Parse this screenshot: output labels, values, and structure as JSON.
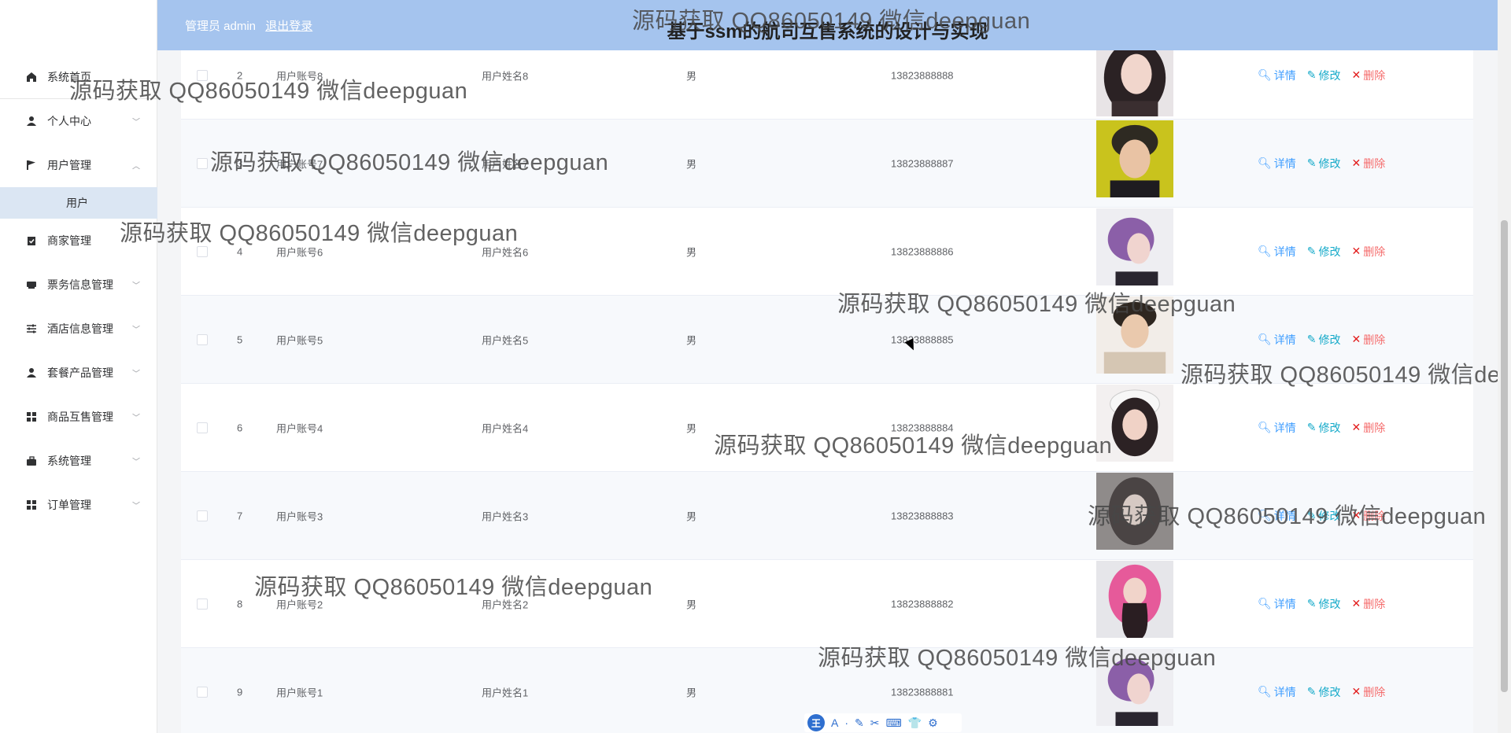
{
  "header": {
    "user_label": "管理员 admin",
    "logout_label": "退出登录",
    "title": "基于ssm的航司互售系统的设计与实现"
  },
  "sidebar": {
    "items": [
      {
        "label": "系统首页",
        "icon": "home-icon"
      },
      {
        "label": "个人中心",
        "icon": "user-icon"
      },
      {
        "label": "用户管理",
        "icon": "flag-icon"
      },
      {
        "label": "商家管理",
        "icon": "clipboard-icon"
      },
      {
        "label": "票务信息管理",
        "icon": "ticket-icon"
      },
      {
        "label": "酒店信息管理",
        "icon": "sliders-icon"
      },
      {
        "label": "套餐产品管理",
        "icon": "user-icon"
      },
      {
        "label": "商品互售管理",
        "icon": "grid-icon"
      },
      {
        "label": "系统管理",
        "icon": "suitcase-icon"
      },
      {
        "label": "订单管理",
        "icon": "grid-icon"
      }
    ],
    "sub_item": "用户"
  },
  "table": {
    "rows": [
      {
        "index": "2",
        "account": "用户账号8",
        "name": "用户姓名8",
        "gender": "男",
        "phone": "13823888888"
      },
      {
        "index": "3",
        "account": "用户账号7",
        "name": "用户姓名7",
        "gender": "男",
        "phone": "13823888887"
      },
      {
        "index": "4",
        "account": "用户账号6",
        "name": "用户姓名6",
        "gender": "男",
        "phone": "13823888886"
      },
      {
        "index": "5",
        "account": "用户账号5",
        "name": "用户姓名5",
        "gender": "男",
        "phone": "13823888885"
      },
      {
        "index": "6",
        "account": "用户账号4",
        "name": "用户姓名4",
        "gender": "男",
        "phone": "13823888884"
      },
      {
        "index": "7",
        "account": "用户账号3",
        "name": "用户姓名3",
        "gender": "男",
        "phone": "13823888883"
      },
      {
        "index": "8",
        "account": "用户账号2",
        "name": "用户姓名2",
        "gender": "男",
        "phone": "13823888882"
      },
      {
        "index": "9",
        "account": "用户账号1",
        "name": "用户姓名1",
        "gender": "男",
        "phone": "13823888881"
      }
    ],
    "actions": {
      "detail": "详情",
      "edit": "修改",
      "delete": "删除"
    }
  },
  "watermark": "源码获取 QQ86050149 微信deepguan",
  "watermark_cut": "源码获取 QQ86050149 微信de",
  "ime": {
    "logo": "王",
    "items": [
      "A",
      "·",
      "✎",
      "✂",
      "⌨",
      "👕",
      "⚙"
    ]
  },
  "colors": {
    "header_bg": "#a5c4ee",
    "submenu_active_bg": "#dbe6f3",
    "detail": "#409eff",
    "edit": "#13a9c9",
    "delete": "#f56c6c"
  }
}
